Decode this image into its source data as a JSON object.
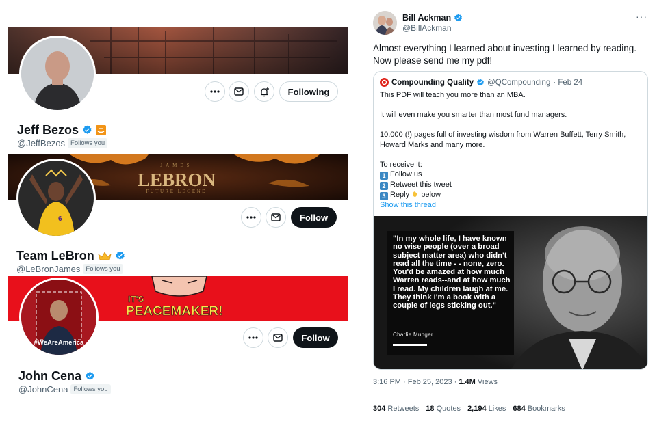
{
  "profiles": [
    {
      "name": "Jeff Bezos",
      "handle": "@JeffBezos",
      "follows_you": "Follows you",
      "primary_button": "Following",
      "extra_badge": "amazon-badge"
    },
    {
      "name": "Team LeBron",
      "handle": "@LeBronJames",
      "follows_you": "Follows you",
      "primary_button": "Follow",
      "banner_title": "LEBRON",
      "banner_top": "JAMES",
      "banner_sub": "FUTURE LEGEND",
      "extra_badge": "crown-emoji"
    },
    {
      "name": "John Cena",
      "handle": "@JohnCena",
      "follows_you": "Follows you",
      "primary_button": "Follow",
      "banner_line1": "IT'S",
      "banner_line2": "PEACEMAKER!",
      "avatar_caption": "#WeAreAmerica"
    }
  ],
  "tweet": {
    "author": "Bill Ackman",
    "handle": "@BillAckman",
    "more": "···",
    "text": "Almost everything I learned about investing I learned by reading. Now please send me my pdf!",
    "quote": {
      "author": "Compounding Quality",
      "handle": "@QCompounding",
      "date": "· Feb 24",
      "line1": "This PDF will teach you more than an MBA.",
      "line2": "It will even make you smarter than most fund managers.",
      "line3": "10.000 (!) pages full of investing wisdom from Warren Buffett, Terry Smith, Howard Marks and many more.",
      "line4": "To receive it:",
      "step1": "Follow us",
      "step2": "Retweet this tweet",
      "step3a": "Reply",
      "step3b": "below",
      "show_thread": "Show this thread",
      "image_quote": "\"In my whole life, I have known no wise people (over a broad subject matter area) who didn't read all the time - - none, zero. You'd be amazed at how much Warren reads--and at how much I read. My children laugh at me. They think I'm a book with a couple of legs sticking out.\"",
      "image_author": "Charlie Munger"
    },
    "timestamp": "3:16 PM · Feb 25, 2023 · ",
    "views_count": "1.4M",
    "views_label": " Views",
    "stats": {
      "retweets_count": "304",
      "retweets_label": "Retweets",
      "quotes_count": "18",
      "quotes_label": "Quotes",
      "likes_count": "2,194",
      "likes_label": "Likes",
      "bookmarks_count": "684",
      "bookmarks_label": "Bookmarks"
    }
  },
  "colors": {
    "verified": "#1d9bf0",
    "dark_button": "#0f1419",
    "cena_banner": "#e8101b"
  }
}
